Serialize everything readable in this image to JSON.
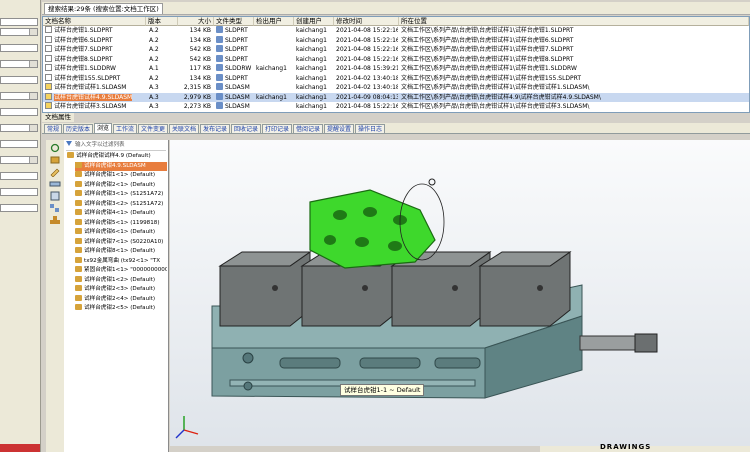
{
  "results": {
    "header": "搜索结果:29条 (搜索位置:文档工作区)",
    "columns": [
      "文档名称",
      "版本",
      "大小",
      "文件类型",
      "检出用户",
      "创建用户",
      "修改时间",
      "所在位置"
    ],
    "rows": [
      {
        "name": "试样台虎钳1.SLDPRT",
        "ver": "A.2",
        "size": "134 KB",
        "type": "SLDPRT",
        "checkout": "",
        "creator": "kaichang1",
        "time": "2021-04-08 15:22:16",
        "loc": "文档工作区\\系列产品\\台虎钳\\台虎钳试样1\\试样台虎钳1.SLDPRT",
        "asm": false
      },
      {
        "name": "试样台虎钳6.SLDPRT",
        "ver": "A.2",
        "size": "134 KB",
        "type": "SLDPRT",
        "checkout": "",
        "creator": "kaichang1",
        "time": "2021-04-08 15:22:16",
        "loc": "文档工作区\\系列产品\\台虎钳\\台虎钳试样1\\试样台虎钳6.SLDPRT",
        "asm": false
      },
      {
        "name": "试样台虎钳7.SLDPRT",
        "ver": "A.2",
        "size": "542 KB",
        "type": "SLDPRT",
        "checkout": "",
        "creator": "kaichang1",
        "time": "2021-04-08 15:22:16",
        "loc": "文档工作区\\系列产品\\台虎钳\\台虎钳试样1\\试样台虎钳7.SLDPRT",
        "asm": false
      },
      {
        "name": "试样台虎钳8.SLDPRT",
        "ver": "A.2",
        "size": "542 KB",
        "type": "SLDPRT",
        "checkout": "",
        "creator": "kaichang1",
        "time": "2021-04-08 15:22:16",
        "loc": "文档工作区\\系列产品\\台虎钳\\台虎钳试样1\\试样台虎钳8.SLDPRT",
        "asm": false
      },
      {
        "name": "试样台虎钳1.SLDDRW",
        "ver": "A.1",
        "size": "117 KB",
        "type": "SLDDRW",
        "checkout": "kaichang1",
        "creator": "kaichang1",
        "time": "2021-04-08 15:39:21",
        "loc": "文档工作区\\系列产品\\台虎钳\\台虎钳试样1\\试样台虎钳1.SLDDRW",
        "asm": false
      },
      {
        "name": "试样台虎钳155.SLDPRT",
        "ver": "A.2",
        "size": "134 KB",
        "type": "SLDPRT",
        "checkout": "",
        "creator": "kaichang1",
        "time": "2021-04-02 13:40:18",
        "loc": "文档工作区\\系列产品\\台虎钳\\台虎钳试样1\\试样台虎钳155.SLDPRT",
        "asm": false
      },
      {
        "name": "试样台虎钳试样1.SLDASM",
        "ver": "A.3",
        "size": "2,315 KB",
        "type": "SLDASM",
        "checkout": "",
        "creator": "kaichang1",
        "time": "2021-04-02 13:40:18",
        "loc": "文档工作区\\系列产品\\台虎钳\\台虎钳试样1\\试样台虎钳试样1.SLDASM\\",
        "asm": true
      },
      {
        "name": "试样台虎钳试样4.9.SLDASM",
        "ver": "A.3",
        "size": "2,979 KB",
        "type": "SLDASM",
        "checkout": "kaichang1",
        "creator": "kaichang1",
        "time": "2021-04-09 08:04:13",
        "loc": "文档工作区\\系列产品\\台虎钳\\台虎钳试样4.9\\试样台虎钳试样4.9.SLDASM\\",
        "asm": true,
        "selected": true
      },
      {
        "name": "试样台虎钳试样3.SLDASM",
        "ver": "A.3",
        "size": "2,273 KB",
        "type": "SLDASM",
        "checkout": "",
        "creator": "kaichang1",
        "time": "2021-04-08 15:22:16",
        "loc": "文档工作区\\系列产品\\台虎钳\\台虎钳试样1\\试样台虎钳试样3.SLDASM\\",
        "asm": true
      }
    ]
  },
  "doc_props": {
    "label": "文档属性",
    "tabs": [
      "常规",
      "历史版本",
      "浏览",
      "工作流",
      "文件变更",
      "关联文档",
      "发布记录",
      "回收记录",
      "打印记录",
      "借阅记录",
      "提醒设置",
      "操作日志"
    ],
    "active_tab": 2
  },
  "tree": {
    "filter_placeholder": "输入文字以过滤列表",
    "nodes": [
      {
        "text": "试样台虎钳试样4.9 (Default)",
        "level": 0,
        "highlight": false
      },
      {
        "text": "试样台虎钳4.9.SLDASM",
        "level": 1,
        "highlight": true
      },
      {
        "text": "试样台虎钳1<1> (Default)",
        "level": 1,
        "highlight": false
      },
      {
        "text": "试样台虎钳2<1> (Default)",
        "level": 1,
        "highlight": false
      },
      {
        "text": "试样台虎钳3<1> (S1251A72)",
        "level": 1,
        "highlight": false
      },
      {
        "text": "试样台虎钳3<2> (S1251A72)",
        "level": 1,
        "highlight": false
      },
      {
        "text": "试样台虎钳4<1> (Default)",
        "level": 1,
        "highlight": false
      },
      {
        "text": "试样台虎钳5<1> (1199818)",
        "level": 1,
        "highlight": false
      },
      {
        "text": "试样台虎钳6<1> (Default)",
        "level": 1,
        "highlight": false
      },
      {
        "text": "试样台虎钳7<1> (S0220A10)",
        "level": 1,
        "highlight": false
      },
      {
        "text": "试样台虎钳8<1> (Default)",
        "level": 1,
        "highlight": false
      },
      {
        "text": "tx92金属弯曲 (tx92<1> \"TX",
        "level": 1,
        "highlight": false
      },
      {
        "text": "紧固台虎钳1<1> \"0000000000",
        "level": 1,
        "highlight": false
      },
      {
        "text": "试样台虎钳1<2> (Default)",
        "level": 1,
        "highlight": false
      },
      {
        "text": "试样台虎钳2<3> (Default)",
        "level": 1,
        "highlight": false
      },
      {
        "text": "试样台虎钳2<4> (Default)",
        "level": 1,
        "highlight": false
      },
      {
        "text": "试样台虎钳2<5> (Default)",
        "level": 1,
        "highlight": false
      }
    ]
  },
  "viewport": {
    "tooltip": "试样台虎钳1-1 ~ Default",
    "logo": "DRAWINGS",
    "highlight_color": "#2fd31b",
    "body_color": "#6f9394"
  },
  "icons": [
    "filter-icon",
    "expand-icon",
    "assembly-icon",
    "part-icon",
    "triad-icon"
  ]
}
